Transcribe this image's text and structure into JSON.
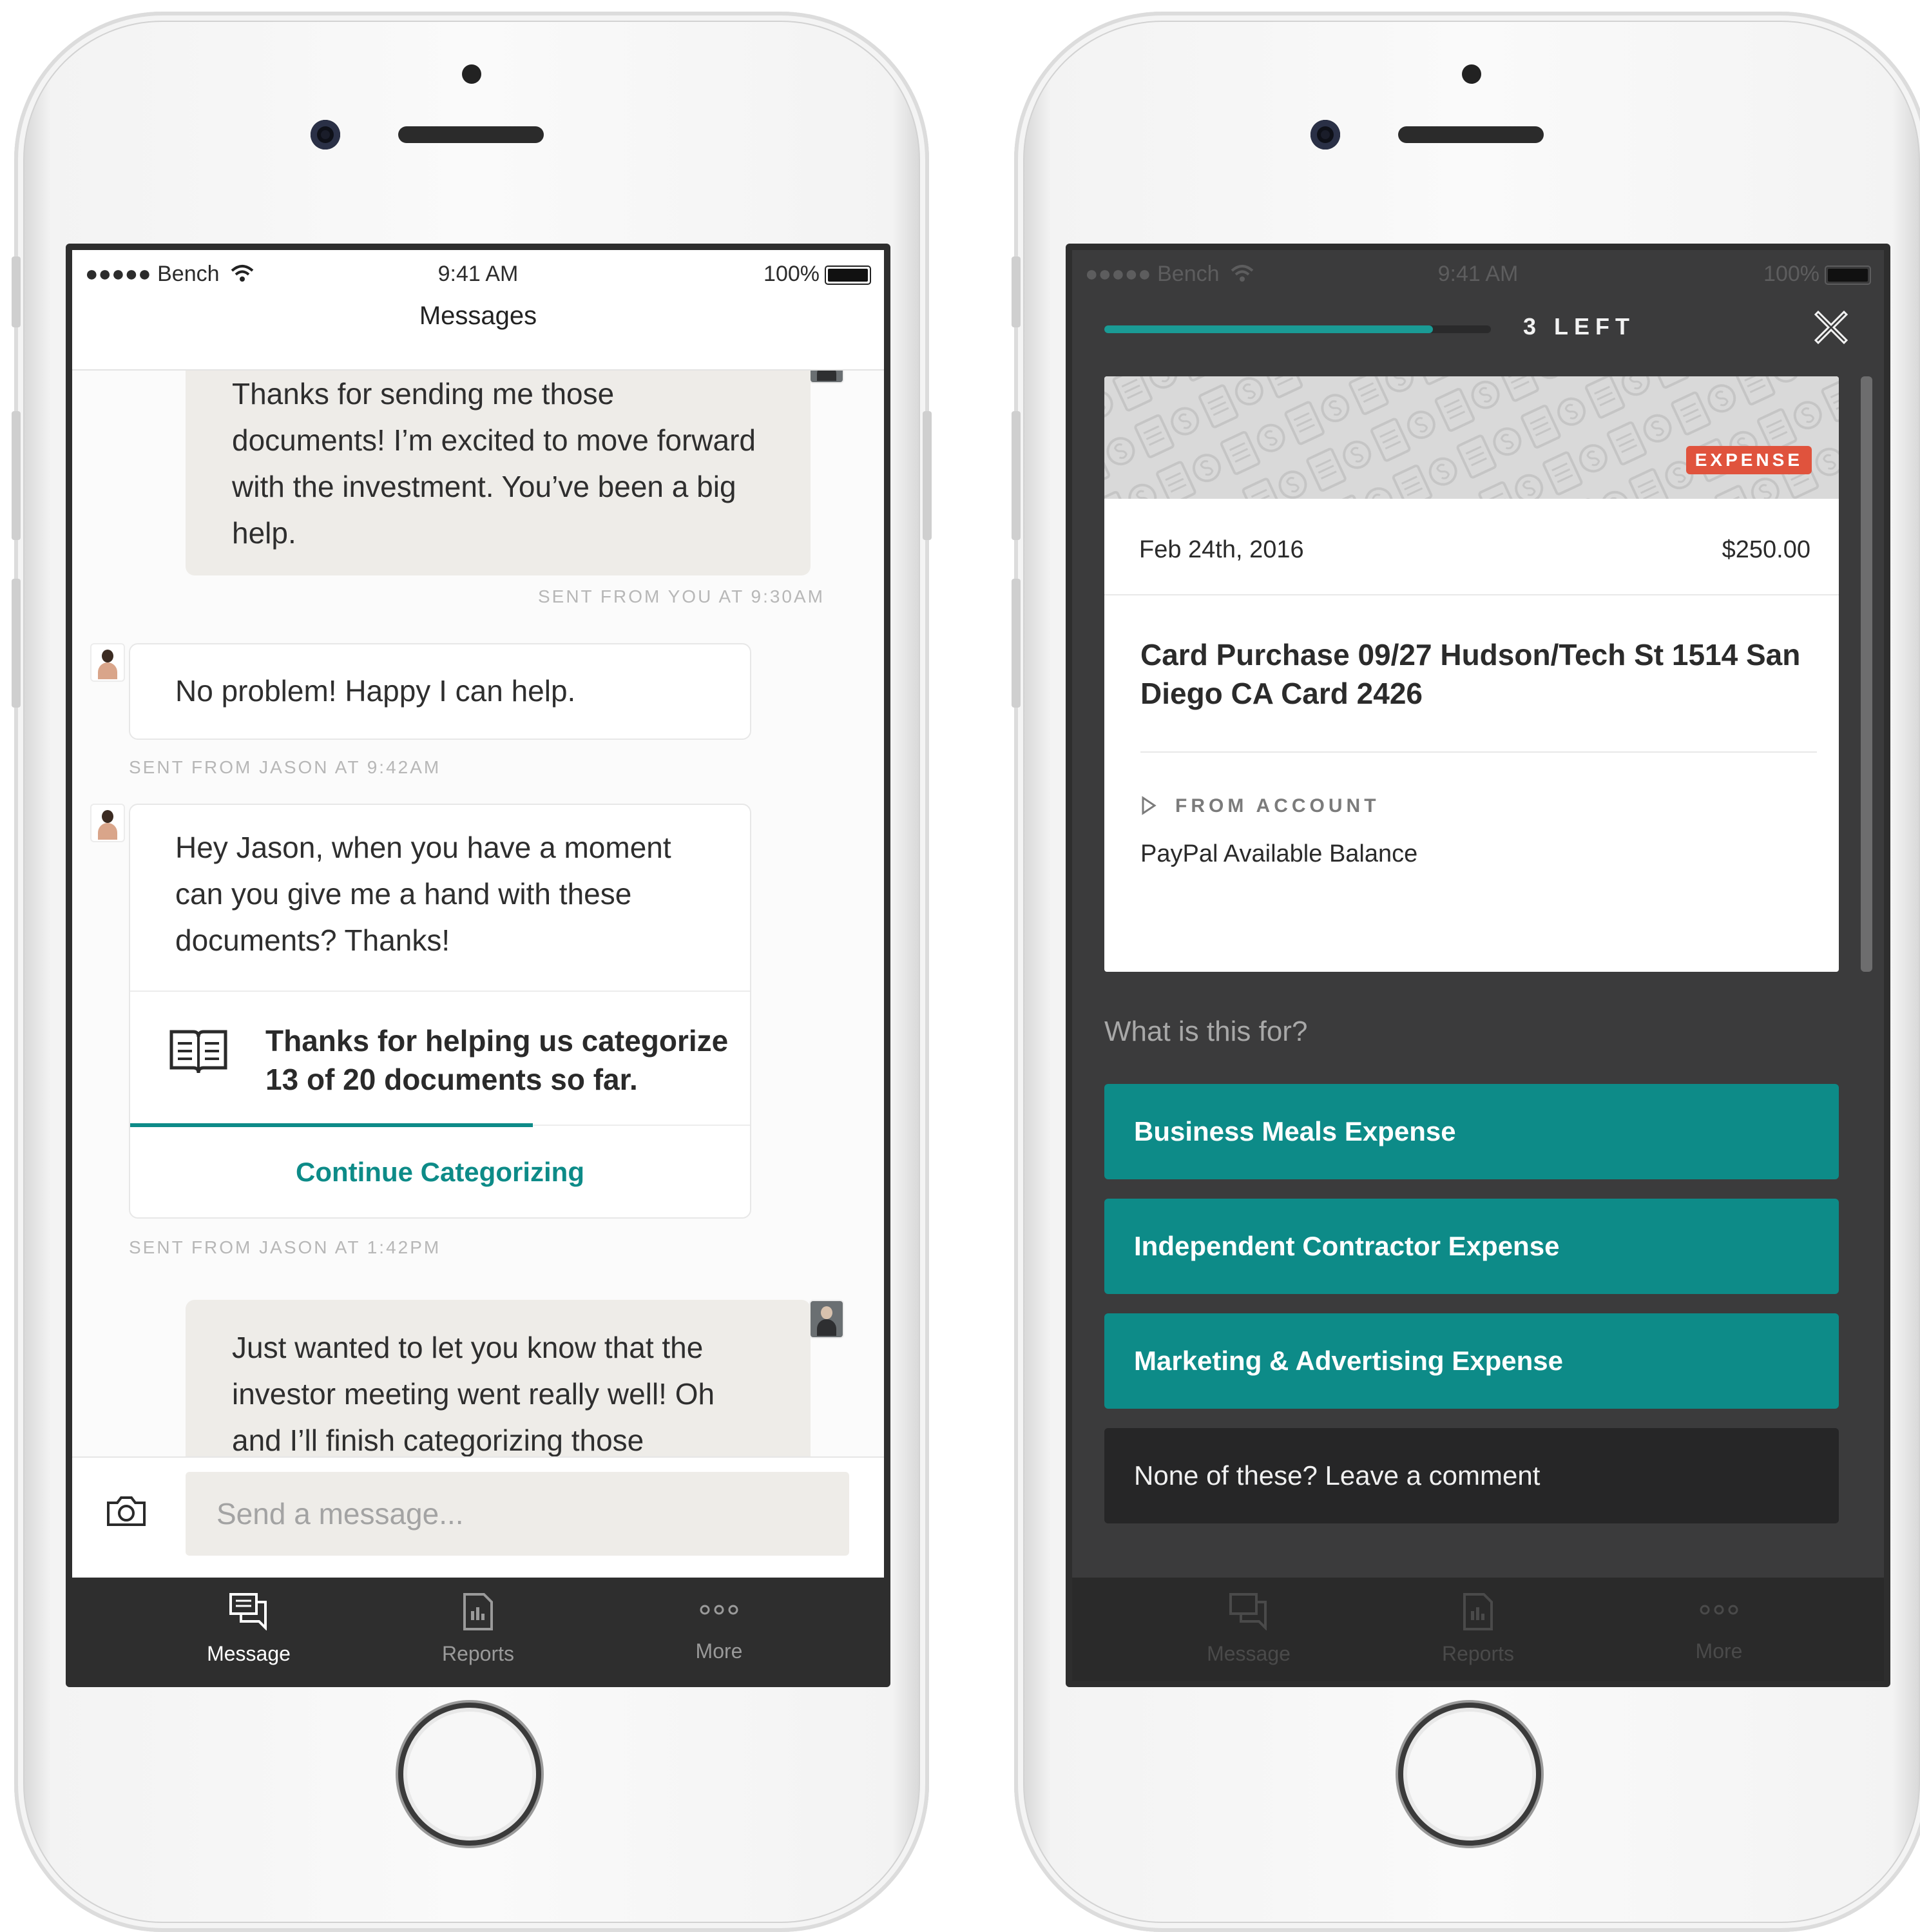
{
  "left_phone": {
    "status": {
      "carrier": "●●●●● Bench",
      "time": "9:41 AM",
      "battery": "100%"
    },
    "nav_title": "Messages",
    "messages": [
      {
        "text": "Thanks for sending me those documents! I’m excited to move forward with the investment. You’ve been a big help.",
        "meta": "SENT FROM YOU AT 9:30AM"
      },
      {
        "text": "No problem! Happy I can help.",
        "meta": "SENT FROM JASON AT 9:42AM"
      },
      {
        "text": "Hey Jason, when you have a moment can you give me a hand with these documents? Thanks!",
        "card_text": "Thanks for helping us categorize 13 of 20 documents so far.",
        "progress": 0.65,
        "action": "Continue Categorizing",
        "meta": "SENT FROM JASON AT 1:42PM"
      },
      {
        "text": "Just wanted to let you know that the investor meeting went really well! Oh and I’ll finish categorizing those"
      }
    ],
    "composer": {
      "placeholder": "Send a message..."
    },
    "tabs": [
      {
        "label": "Message",
        "icon": "message-icon"
      },
      {
        "label": "Reports",
        "icon": "reports-icon"
      },
      {
        "label": "More",
        "icon": "more-icon"
      }
    ],
    "colors": {
      "accent": "#0d8b88",
      "tab_bar": "#2e2e2e"
    }
  },
  "right_phone": {
    "status": {
      "carrier": "●●●●● Bench",
      "time": "9:41 AM",
      "battery": "100%"
    },
    "progress": 0.85,
    "remaining": "3 LEFT",
    "card": {
      "badge": "EXPENSE",
      "date": "Feb 24th, 2016",
      "amount": "$250.00",
      "title": "Card Purchase 09/27 Hudson/Tech St 1514 San Diego CA Card 2426",
      "from_label": "FROM ACCOUNT",
      "from_value": "PayPal Available Balance"
    },
    "question": "What is this for?",
    "options": [
      "Business Meals Expense",
      "Independent Contractor Expense",
      "Marketing & Advertising Expense"
    ],
    "comment_option": "None of these? Leave a comment",
    "tabs": [
      {
        "label": "Message"
      },
      {
        "label": "Reports"
      },
      {
        "label": "More"
      }
    ],
    "colors": {
      "accent": "#0d8b88",
      "badge": "#e0533d",
      "background": "#3b3b3c"
    }
  }
}
